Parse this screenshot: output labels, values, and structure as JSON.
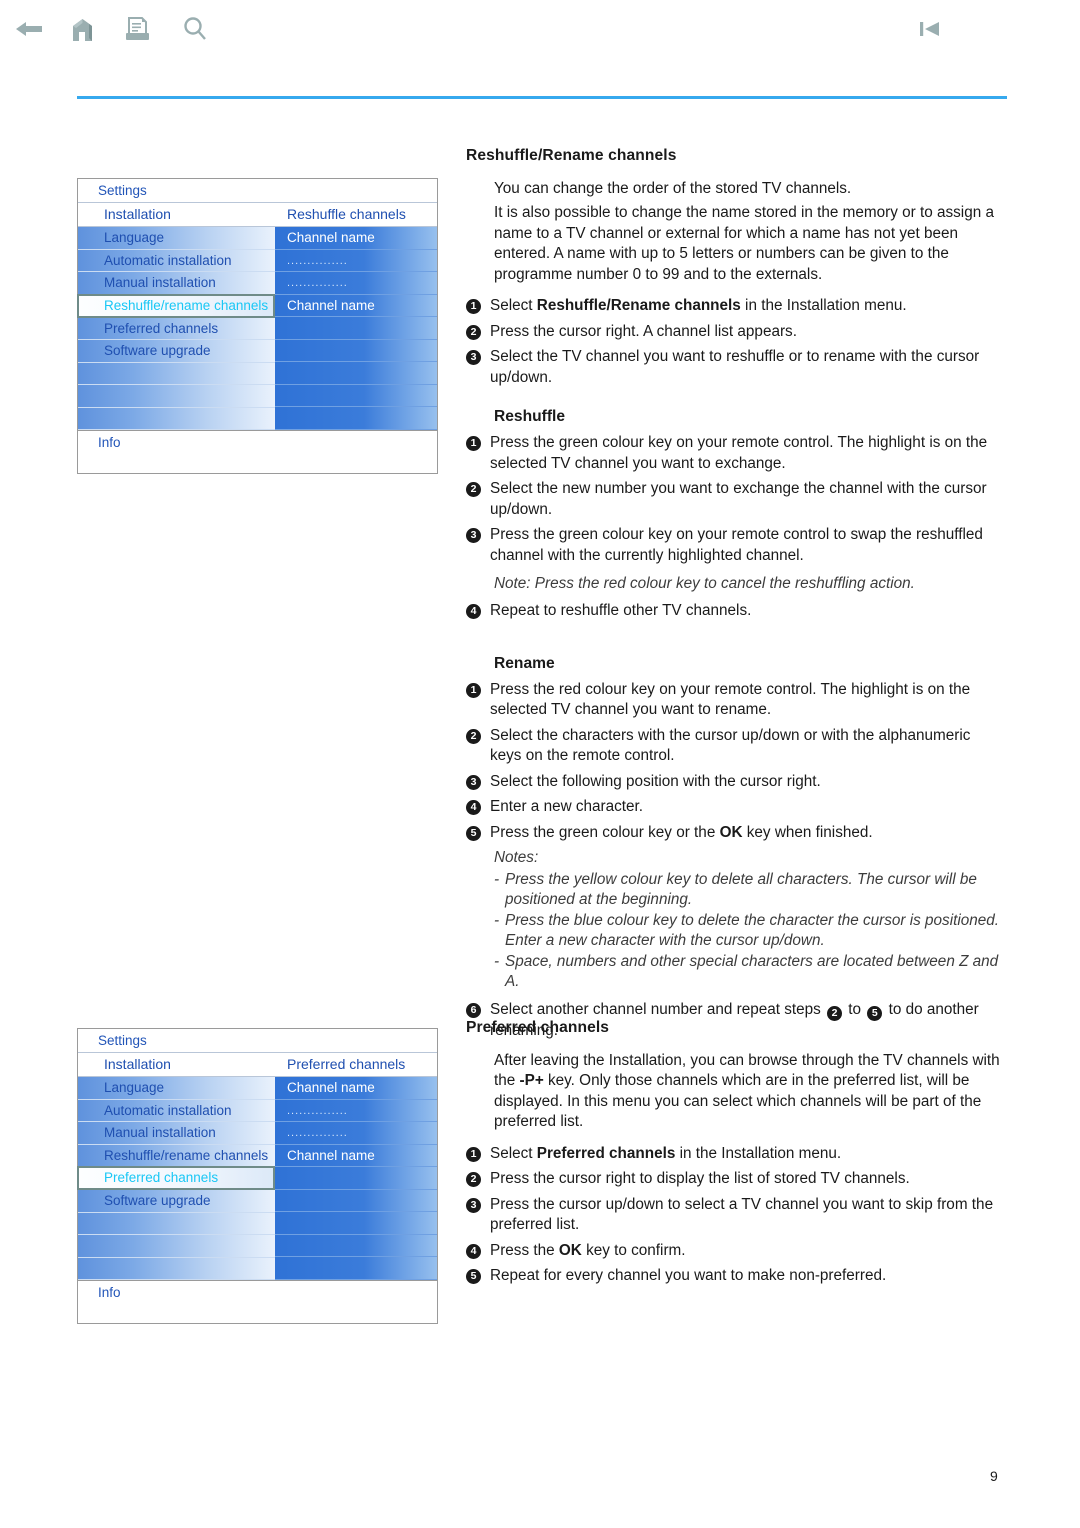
{
  "toolbar": {
    "icons": [
      {
        "name": "back-arrow-icon",
        "label": "Back"
      },
      {
        "name": "home-icon",
        "label": "Home"
      },
      {
        "name": "print-icon",
        "label": "Print"
      },
      {
        "name": "search-icon",
        "label": "Search"
      },
      {
        "name": "previous-page-icon",
        "label": "Previous"
      }
    ],
    "rule_color": "#36a9ee"
  },
  "menu_top": {
    "title": "Settings",
    "head_left": "Installation",
    "head_right": "Reshuffle channels",
    "left_items": [
      {
        "label": "Language",
        "selected": false
      },
      {
        "label": "Automatic installation",
        "selected": false
      },
      {
        "label": "Manual installation",
        "selected": false
      },
      {
        "label": "Reshuffle/rename channels",
        "selected": true
      },
      {
        "label": "Preferred channels",
        "selected": false
      },
      {
        "label": "Software upgrade",
        "selected": false
      },
      {
        "label": "",
        "selected": false
      },
      {
        "label": "",
        "selected": false
      },
      {
        "label": "",
        "selected": false
      }
    ],
    "right_items": [
      {
        "label": "Channel name",
        "dots": false
      },
      {
        "label": "...............",
        "dots": true
      },
      {
        "label": "...............",
        "dots": true
      },
      {
        "label": "Channel name",
        "dots": false
      },
      {
        "label": "",
        "dots": false
      },
      {
        "label": "",
        "dots": false
      },
      {
        "label": "",
        "dots": false
      },
      {
        "label": "",
        "dots": false
      },
      {
        "label": "",
        "dots": false
      }
    ],
    "info": "Info",
    "highlight_text_color": "#19c7f5",
    "item_text_color": "#1f4fb0"
  },
  "menu_bottom": {
    "title": "Settings",
    "head_left": "Installation",
    "head_right": "Preferred channels",
    "left_items": [
      {
        "label": "Language",
        "selected": false
      },
      {
        "label": "Automatic installation",
        "selected": false
      },
      {
        "label": "Manual installation",
        "selected": false
      },
      {
        "label": "Reshuffle/rename channels",
        "selected": false
      },
      {
        "label": "Preferred channels",
        "selected": true
      },
      {
        "label": "Software upgrade",
        "selected": false
      },
      {
        "label": "",
        "selected": false
      },
      {
        "label": "",
        "selected": false
      },
      {
        "label": "",
        "selected": false
      }
    ],
    "right_items": [
      {
        "label": "Channel name",
        "dots": false
      },
      {
        "label": "...............",
        "dots": true
      },
      {
        "label": "...............",
        "dots": true
      },
      {
        "label": "Channel name",
        "dots": false
      },
      {
        "label": "",
        "dots": false
      },
      {
        "label": "",
        "dots": false
      },
      {
        "label": "",
        "dots": false
      },
      {
        "label": "",
        "dots": false
      },
      {
        "label": "",
        "dots": false
      }
    ],
    "info": "Info"
  },
  "section_reshuffle_rename": {
    "heading": "Reshuffle/Rename channels",
    "intro_line_1": "You can change the order of the stored TV channels.",
    "intro_line_2": "It is also possible to change the name stored in the memory or to assign a name to a TV channel or external for which a name has not yet been entered. A name with up to 5 letters or numbers can be given to the programme number 0 to 99 and to the externals.",
    "step1_pre": "Select ",
    "step1_bold": "Reshuffle/Rename channels",
    "step1_post": " in the Installation menu.",
    "step2": "Press the cursor right. A channel list appears.",
    "step3": "Select the TV channel you want to reshuffle or to rename with the cursor up/down."
  },
  "section_reshuffle": {
    "heading": "Reshuffle",
    "step1": "Press the green colour key on your remote control. The highlight is on the selected TV channel you want to exchange.",
    "step2": "Select the new number you want to exchange the channel with the cursor up/down.",
    "step3": "Press the green colour key on your remote control to swap the reshuffled channel with the currently highlighted channel.",
    "note": "Note: Press the red colour key to cancel the reshuffling action.",
    "step4": "Repeat to reshuffle other TV channels."
  },
  "section_rename": {
    "heading": "Rename",
    "step1": "Press the red colour key on your remote control. The highlight is on the selected TV channel you want to rename.",
    "step2": "Select the characters with the cursor up/down or with the alphanumeric keys on the remote control.",
    "step3": "Select the following position with the cursor right.",
    "step4": "Enter a new character.",
    "step5_pre": "Press the green colour key or the ",
    "step5_bold": "OK",
    "step5_post": " key when finished.",
    "notes_head": "Notes:",
    "note1": "Press the yellow colour key to delete all characters. The cursor will be positioned at the beginning.",
    "note2": "Press the blue colour key to delete the character the cursor is positioned. Enter a new character with the cursor up/down.",
    "note3": "Space, numbers and other special characters are located between Z and A.",
    "step6_pre": "Select another channel number and repeat steps ",
    "step6_mid": " to ",
    "step6_post": " to do another renaming.",
    "step6_ref_a": "2",
    "step6_ref_b": "5"
  },
  "section_preferred": {
    "heading": "Preferred channels",
    "intro_pre": "After leaving the Installation, you can browse through the TV channels with the ",
    "intro_bold": "-P+",
    "intro_post": " key. Only those channels which are in the preferred list, will be displayed. In this menu you can select which channels will be part of the preferred list.",
    "step1_pre": "Select ",
    "step1_bold": "Preferred channels",
    "step1_post": " in the Installation menu.",
    "step2": "Press the cursor right to display the list of stored TV channels.",
    "step3": "Press the cursor up/down to select a TV channel you want to skip from the preferred list.",
    "step4_pre": "Press the ",
    "step4_bold": "OK",
    "step4_post": " key to confirm.",
    "step5": "Repeat for every channel you want to make non-preferred."
  },
  "footer": {
    "page_number": "9"
  }
}
